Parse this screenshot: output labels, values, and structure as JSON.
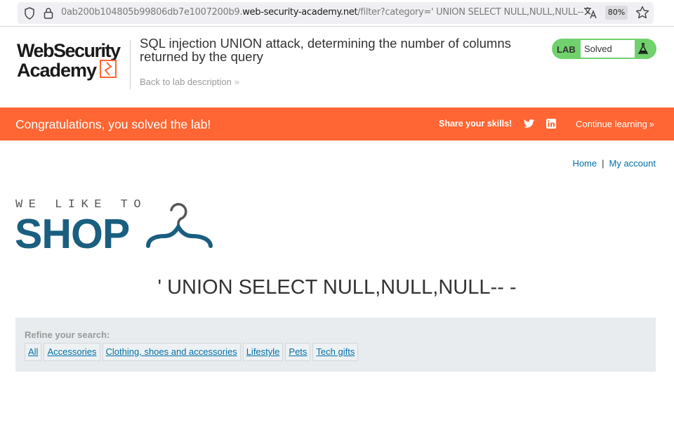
{
  "browser": {
    "url_prefix": "0ab200b104805b99806db7e1007200b9.",
    "url_host": "web-security-academy.net",
    "url_path": "/filter?category=' UNION SELECT NULL,NULL,NULL-- -",
    "zoom": "80%"
  },
  "academy": {
    "logo_line1": "WebSecurity",
    "logo_line2": "Academy",
    "lab_title": "SQL injection UNION attack, determining the number of columns returned by the query",
    "back_link": "Back to lab description",
    "lab_badge": "LAB",
    "lab_status": "Solved"
  },
  "banner": {
    "title": "Congratulations, you solved the lab!",
    "share_label": "Share your skills!",
    "continue_label": "Continue learning"
  },
  "nav": {
    "home": "Home",
    "separator": "|",
    "account": "My account"
  },
  "shop_logo": {
    "tagline": "WE LIKE TO",
    "word": "SHOP"
  },
  "search_heading": "' UNION SELECT NULL,NULL,NULL-- -",
  "filters": {
    "label": "Refine your search:",
    "items": [
      "All",
      "Accessories",
      "Clothing, shoes and accessories",
      "Lifestyle",
      "Pets",
      "Tech gifts"
    ]
  },
  "colors": {
    "banner": "#ff6633",
    "link": "#0070a8",
    "lab_green": "#70d16d",
    "shop_blue": "#1a5e80"
  },
  "icons": [
    "shield-icon",
    "lock-icon",
    "translate-icon",
    "star-icon",
    "flask-icon",
    "twitter-icon",
    "linkedin-icon",
    "hanger-icon"
  ]
}
